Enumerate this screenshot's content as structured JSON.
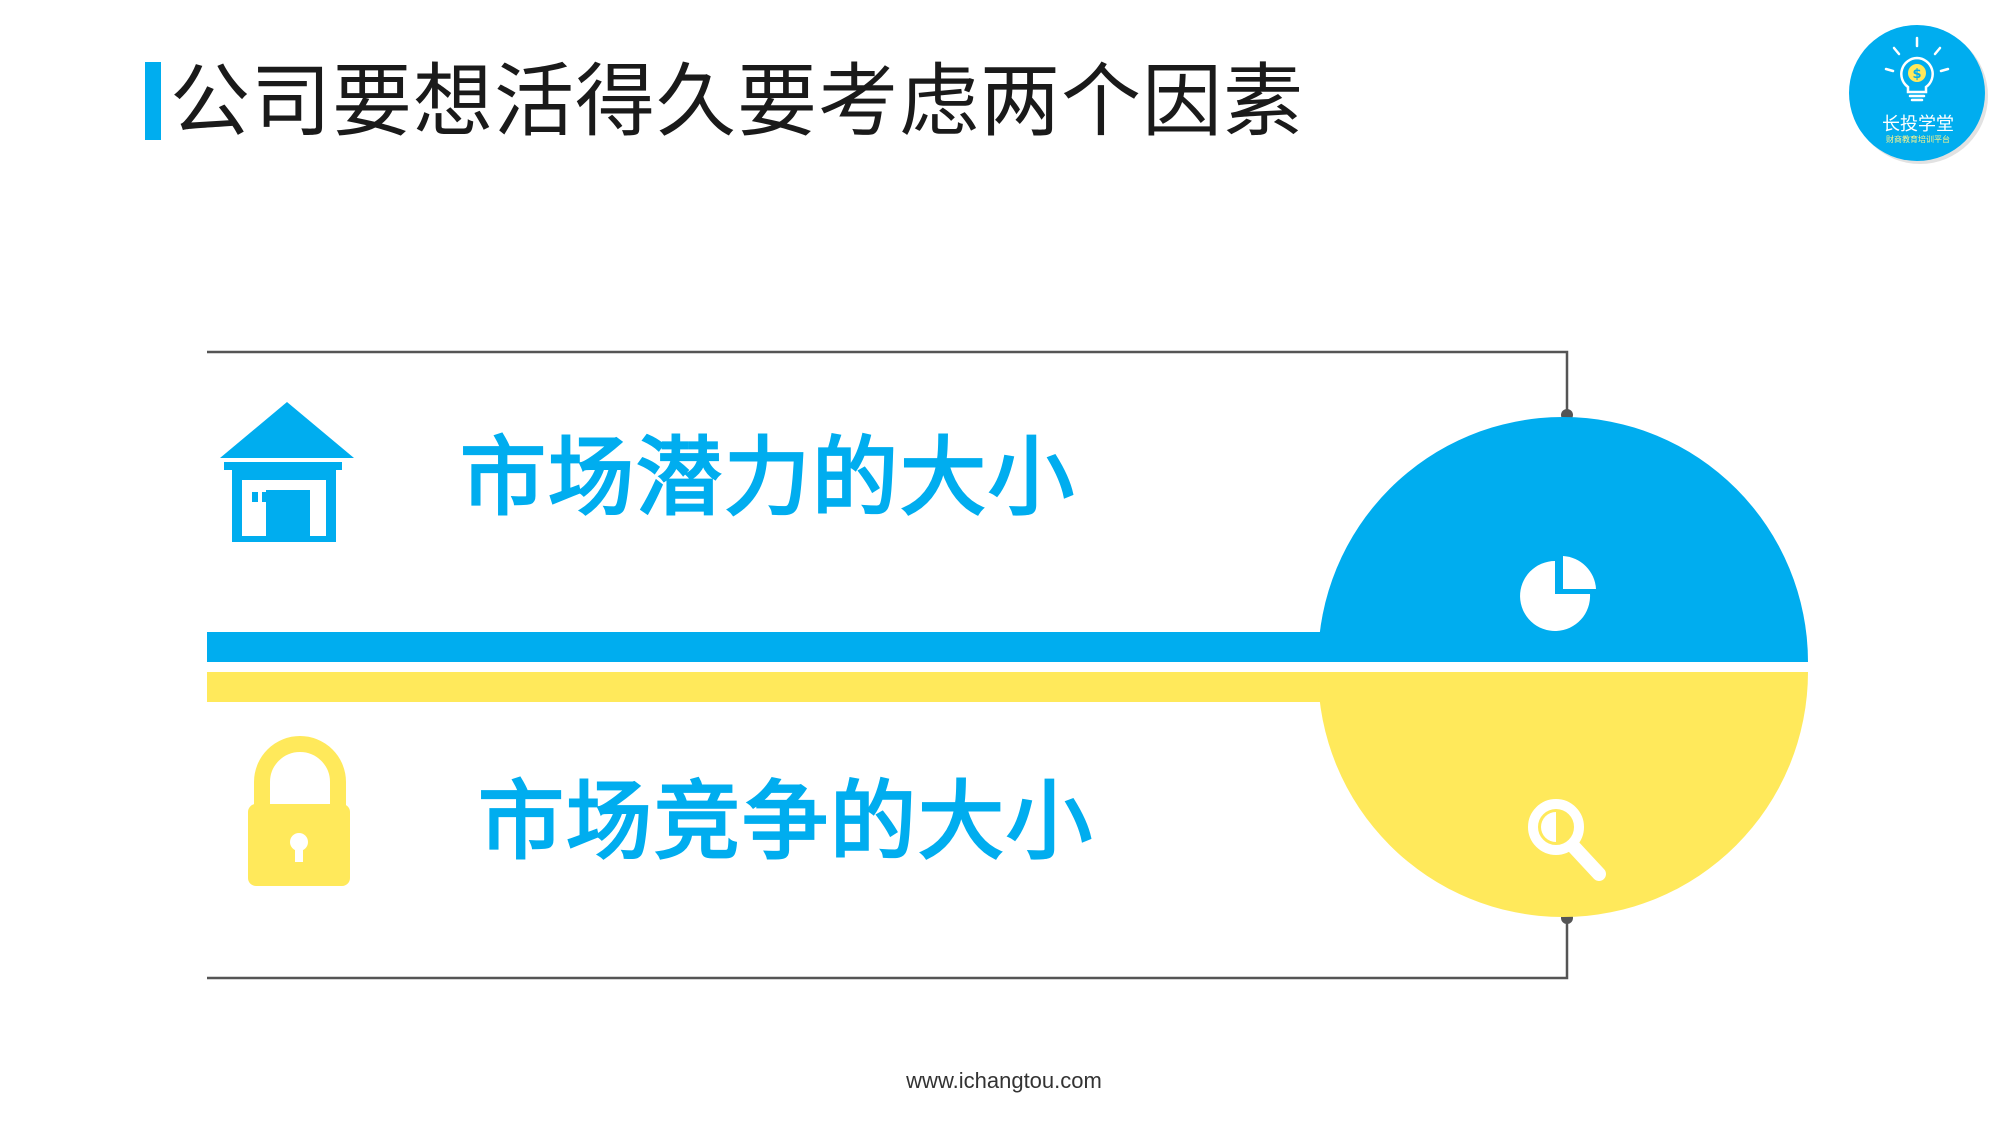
{
  "slide": {
    "title": "公司要想活得久要考虑两个因素",
    "factors": [
      {
        "label": "市场潜力的大小",
        "icon": "house-icon",
        "accent_icon": "pie-chart-icon"
      },
      {
        "label": "市场竞争的大小",
        "icon": "padlock-icon",
        "accent_icon": "magnifier-icon"
      }
    ],
    "footer": "www.ichangtou.com"
  },
  "logo": {
    "label": "长投学堂",
    "subtitle": "财商教育培训平台"
  },
  "colors": {
    "blue": "#00adef",
    "yellow": "#ffe95b",
    "title_text": "#1a1a1a",
    "line": "#555555"
  }
}
